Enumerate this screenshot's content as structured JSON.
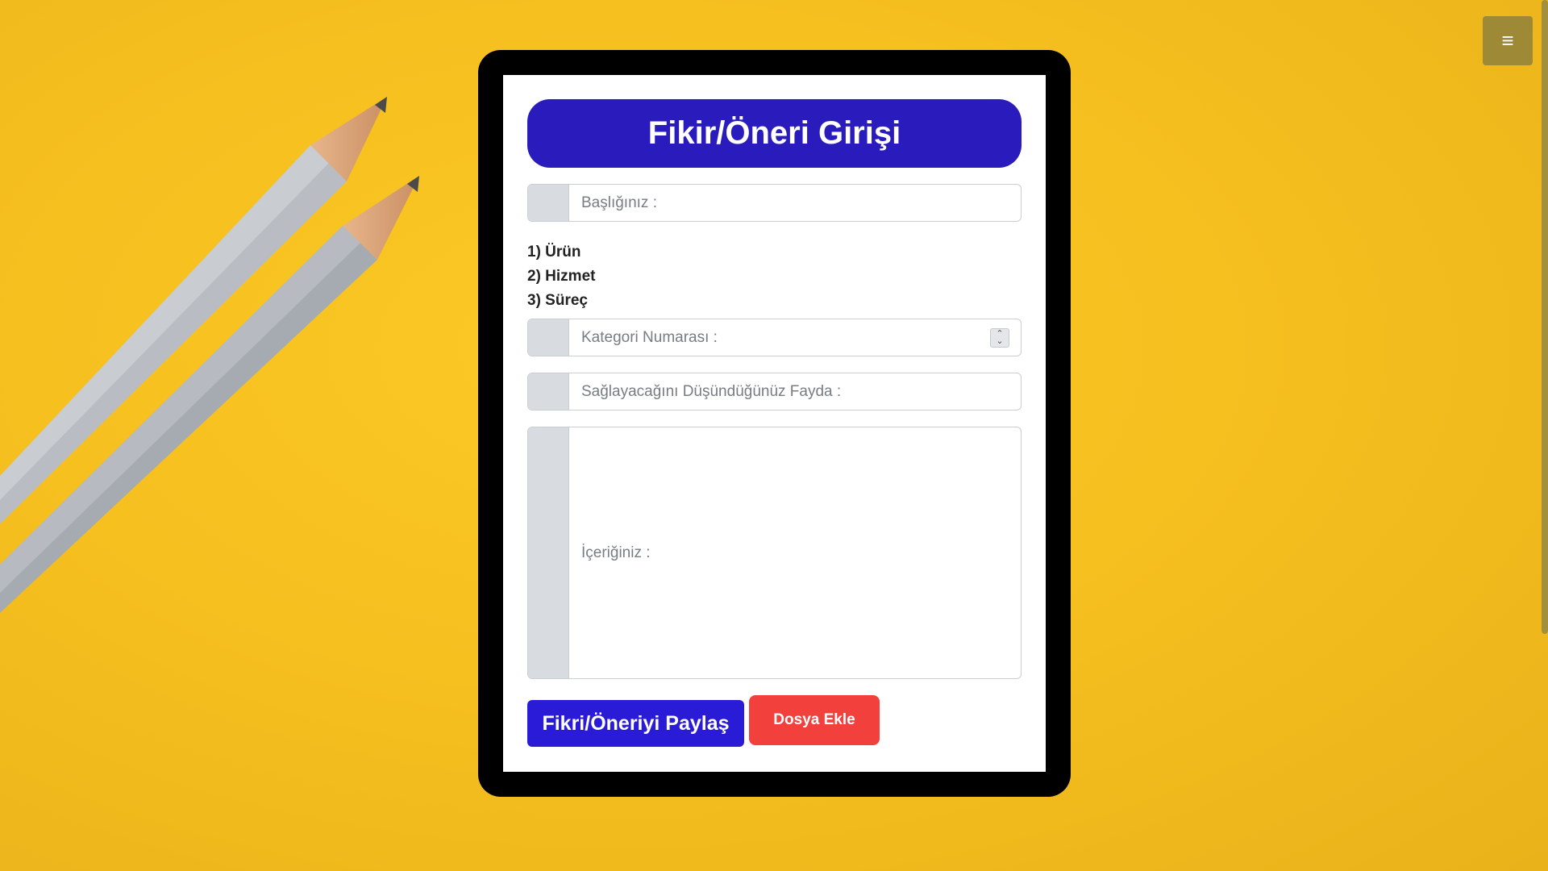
{
  "menu": {
    "icon": "hamburger-menu-icon",
    "glyph": "≡"
  },
  "form": {
    "title": "Fikir/Öneri Girişi",
    "title_placeholder": "Başlığınız :",
    "categories": [
      "1) Ürün",
      "2) Hizmet",
      "3) Süreç"
    ],
    "category_placeholder": "Kategori Numarası :",
    "benefit_placeholder": "Sağlayacağını Düşündüğünüz Fayda :",
    "content_placeholder": "İçeriğiniz :",
    "share_button": "Fikri/Öneriyi Paylaş",
    "file_button": "Dosya Ekle"
  },
  "colors": {
    "background": "#f6c01f",
    "title_bar": "#2a1bbd",
    "share_button": "#2a1bd6",
    "file_button": "#f2413d",
    "menu_button": "#9e8a36"
  }
}
